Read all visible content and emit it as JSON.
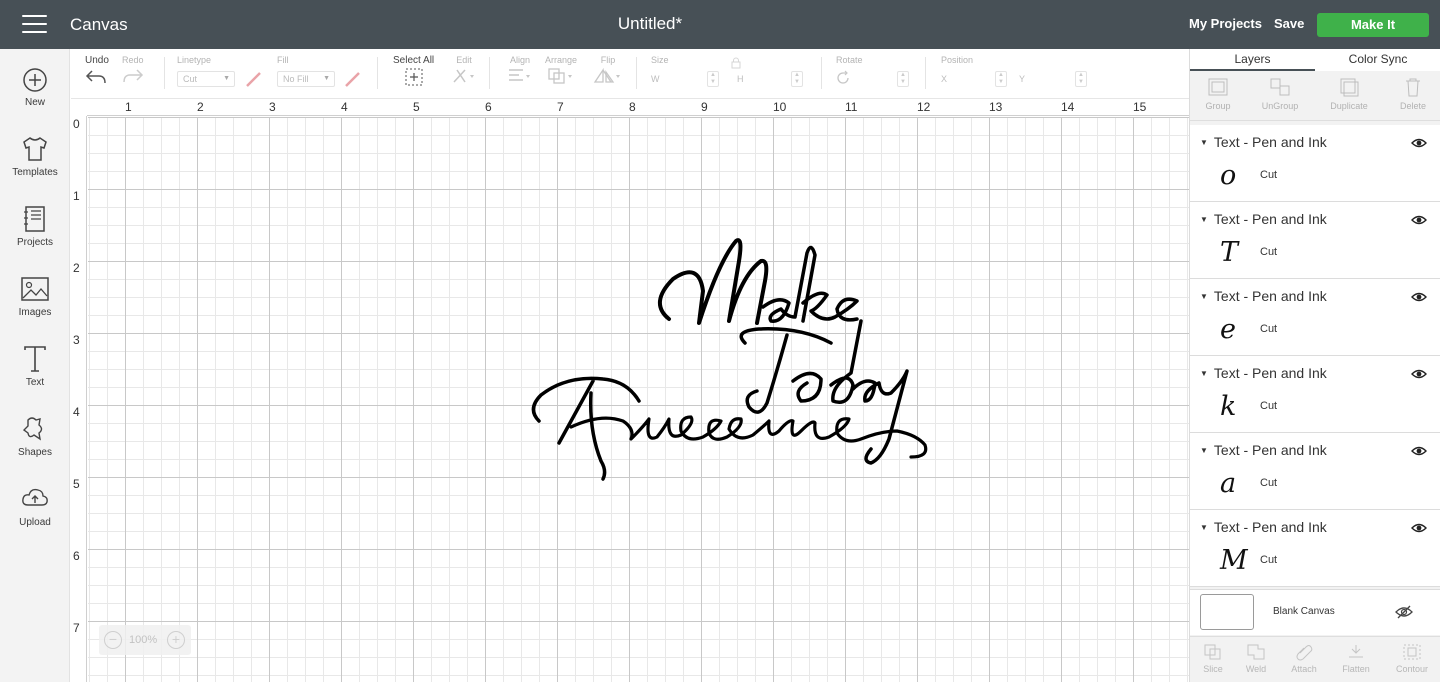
{
  "topbar": {
    "app_name": "Canvas",
    "document_title": "Untitled*",
    "my_projects": "My Projects",
    "save": "Save",
    "make_it": "Make It",
    "accent_color": "#3fb14a",
    "bar_color": "#475056"
  },
  "leftbar": {
    "items": [
      {
        "label": "New",
        "icon": "plus-circle-icon"
      },
      {
        "label": "Templates",
        "icon": "tshirt-icon"
      },
      {
        "label": "Projects",
        "icon": "notebook-icon"
      },
      {
        "label": "Images",
        "icon": "image-icon"
      },
      {
        "label": "Text",
        "icon": "text-T-icon"
      },
      {
        "label": "Shapes",
        "icon": "shapes-icon"
      },
      {
        "label": "Upload",
        "icon": "cloud-upload-icon"
      }
    ]
  },
  "toolbar": {
    "undo": "Undo",
    "redo": "Redo",
    "linetype_label": "Linetype",
    "linetype_value": "Cut",
    "fill_label": "Fill",
    "fill_value": "No Fill",
    "select_all": "Select All",
    "edit": "Edit",
    "align": "Align",
    "arrange": "Arrange",
    "flip": "Flip",
    "size": "Size",
    "width_label": "W",
    "height_label": "H",
    "rotate": "Rotate",
    "position": "Position",
    "x_label": "X",
    "y_label": "Y"
  },
  "canvas": {
    "ruler_top": [
      "1",
      "2",
      "3",
      "4",
      "5",
      "6",
      "7",
      "8",
      "9",
      "10",
      "11",
      "12",
      "13",
      "14",
      "15"
    ],
    "ruler_left": [
      "0",
      "1",
      "2",
      "3",
      "4",
      "5",
      "6",
      "7"
    ],
    "zoom": "100%",
    "artwork_lines": [
      "Make",
      "Today",
      "Awesome"
    ]
  },
  "rightpanel": {
    "tabs": [
      "Layers",
      "Color Sync"
    ],
    "tools": [
      "Group",
      "UnGroup",
      "Duplicate",
      "Delete"
    ],
    "layers": [
      {
        "name": "Text - Pen and Ink",
        "glyph": "o",
        "operation": "Cut"
      },
      {
        "name": "Text - Pen and Ink",
        "glyph": "T",
        "operation": "Cut"
      },
      {
        "name": "Text - Pen and Ink",
        "glyph": "e",
        "operation": "Cut"
      },
      {
        "name": "Text - Pen and Ink",
        "glyph": "k",
        "operation": "Cut"
      },
      {
        "name": "Text - Pen and Ink",
        "glyph": "a",
        "operation": "Cut"
      },
      {
        "name": "Text - Pen and Ink",
        "glyph": "M",
        "operation": "Cut"
      }
    ],
    "blank_canvas": "Blank Canvas",
    "bottom_tools": [
      "Slice",
      "Weld",
      "Attach",
      "Flatten",
      "Contour"
    ]
  }
}
